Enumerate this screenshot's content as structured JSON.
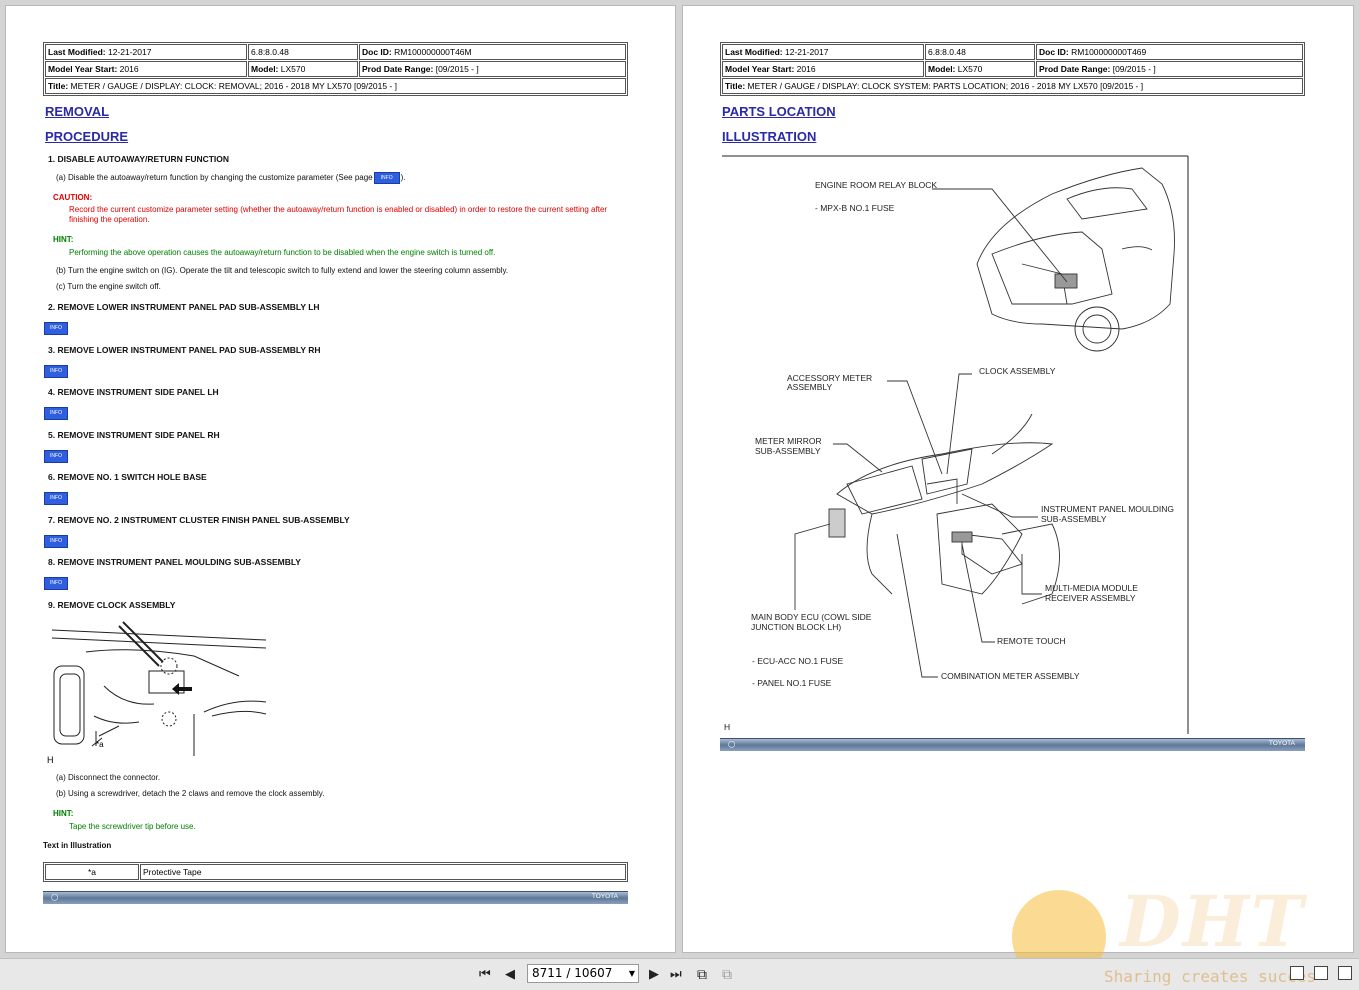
{
  "left": {
    "header": {
      "last_modified_label": "Last Modified:",
      "last_modified": "12-21-2017",
      "version": "6.8:8.0.48",
      "doc_id_label": "Doc ID:",
      "doc_id": "RM100000000T46M",
      "model_year_label": "Model Year Start:",
      "model_year": "2016",
      "model_label": "Model:",
      "model": "LX570",
      "prod_date_label": "Prod Date Range:",
      "prod_date": "[09/2015 -          ]",
      "title_label": "Title:",
      "title": "METER / GAUGE / DISPLAY: CLOCK: REMOVAL; 2016 - 2018 MY LX570 [09/2015 -          ]"
    },
    "removal": "REMOVAL",
    "procedure": "PROCEDURE",
    "step1": "1. DISABLE AUTOAWAY/RETURN FUNCTION",
    "step1a": "(a) Disable the autoaway/return function by changing the customize parameter (See page",
    "step1a_end": ").",
    "caution_label": "CAUTION:",
    "caution_text": "Record the current customize parameter setting (whether the autoaway/return function is enabled or disabled) in order to restore the current setting after finishing the operation.",
    "hint_label": "HINT:",
    "hint_text": "Performing the above operation causes the autoaway/return function to be disabled when the engine switch is turned off.",
    "step1b": "(b) Turn the engine switch on (IG). Operate the tilt and telescopic switch to fully extend and lower the steering column assembly.",
    "step1c": "(c) Turn the engine switch off.",
    "steps": [
      "2. REMOVE LOWER INSTRUMENT PANEL PAD SUB-ASSEMBLY LH",
      "3. REMOVE LOWER INSTRUMENT PANEL PAD SUB-ASSEMBLY RH",
      "4. REMOVE INSTRUMENT SIDE PANEL LH",
      "5. REMOVE INSTRUMENT SIDE PANEL RH",
      "6. REMOVE NO. 1 SWITCH HOLE BASE",
      "7. REMOVE NO. 2 INSTRUMENT CLUSTER FINISH PANEL SUB-ASSEMBLY",
      "8. REMOVE INSTRUMENT PANEL MOULDING SUB-ASSEMBLY"
    ],
    "info_label": "INFO",
    "step9": "9. REMOVE CLOCK ASSEMBLY",
    "fig_a": "*a",
    "fig_h": "H",
    "step9a": "(a) Disconnect the connector.",
    "step9b": "(b) Using a screwdriver, detach the 2 claws and remove the clock assembly.",
    "hint2_label": "HINT:",
    "hint2_text": "Tape the screwdriver tip before use.",
    "text_in_illustration": "Text in Illustration",
    "table": {
      "key": "*a",
      "value": "Protective Tape"
    },
    "footer_logo": "TOYOTA"
  },
  "right": {
    "header": {
      "last_modified_label": "Last Modified:",
      "last_modified": "12-21-2017",
      "version": "6.8:8.0.48",
      "doc_id_label": "Doc ID:",
      "doc_id": "RM100000000T469",
      "model_year_label": "Model Year Start:",
      "model_year": "2016",
      "model_label": "Model:",
      "model": "LX570",
      "prod_date_label": "Prod Date Range:",
      "prod_date": "[09/2015 -          ]",
      "title_label": "Title:",
      "title": "METER / GAUGE / DISPLAY: CLOCK SYSTEM: PARTS LOCATION; 2016 - 2018 MY LX570 [09/2015 -          ]"
    },
    "parts_location": "PARTS LOCATION",
    "illustration": "ILLUSTRATION",
    "labels": {
      "engine_room": "ENGINE ROOM RELAY BLOCK",
      "mpx": "- MPX-B NO.1 FUSE",
      "accessory_1": "ACCESSORY METER",
      "accessory_2": "ASSEMBLY",
      "clock": "CLOCK ASSEMBLY",
      "mirror_1": "METER MIRROR",
      "mirror_2": "SUB-ASSEMBLY",
      "moulding_1": "INSTRUMENT PANEL MOULDING",
      "moulding_2": "SUB-ASSEMBLY",
      "multimedia_1": "MULTI-MEDIA MODULE",
      "multimedia_2": "RECEIVER ASSEMBLY",
      "main_body_1": "MAIN BODY ECU (COWL SIDE",
      "main_body_2": "JUNCTION BLOCK LH)",
      "remote": "REMOTE TOUCH",
      "ecu_acc": "- ECU-ACC NO.1 FUSE",
      "panel": "- PANEL NO.1 FUSE",
      "combination": "COMBINATION METER ASSEMBLY",
      "h": "H"
    },
    "footer_logo": "TOYOTA"
  },
  "toolbar": {
    "page_display": "8711 / 10607",
    "first_icon": "first-page-icon",
    "prev_icon": "prev-page-icon",
    "next_icon": "next-page-icon",
    "last_icon": "last-page-icon"
  },
  "watermark": {
    "brand": "DHT",
    "slogan": "Sharing creates succes"
  }
}
